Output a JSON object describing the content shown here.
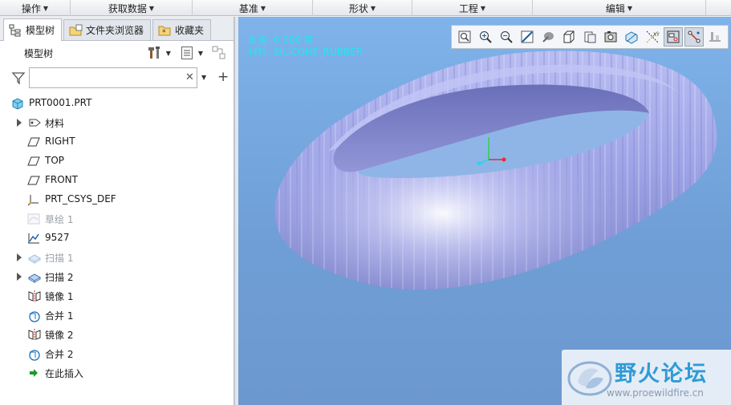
{
  "ribbon": {
    "groups": [
      {
        "label": "操作",
        "width": 88
      },
      {
        "label": "获取数据",
        "width": 152
      },
      {
        "label": "基准",
        "width": 150
      },
      {
        "label": "形状",
        "width": 124
      },
      {
        "label": "工程",
        "width": 150
      },
      {
        "label": "编辑",
        "width": 216
      }
    ]
  },
  "tabs": [
    {
      "label": "模型树",
      "icon": "model-tree-icon",
      "active": true
    },
    {
      "label": "文件夹浏览器",
      "icon": "folder-browser-icon",
      "active": false
    },
    {
      "label": "收藏夹",
      "icon": "favorites-icon",
      "active": false
    }
  ],
  "tree_header": {
    "title": "模型树"
  },
  "search": {
    "value": "",
    "placeholder": ""
  },
  "tree": {
    "root": {
      "label": "PRT0001.PRT",
      "icon": "part-icon"
    },
    "items": [
      {
        "label": "材料",
        "icon": "material-icon",
        "expandable": true,
        "dim": false
      },
      {
        "label": "RIGHT",
        "icon": "datum-plane-icon",
        "expandable": false,
        "dim": false
      },
      {
        "label": "TOP",
        "icon": "datum-plane-icon",
        "expandable": false,
        "dim": false
      },
      {
        "label": "FRONT",
        "icon": "datum-plane-icon",
        "expandable": false,
        "dim": false
      },
      {
        "label": "PRT_CSYS_DEF",
        "icon": "csys-icon",
        "expandable": false,
        "dim": false
      },
      {
        "label": "草绘 1",
        "icon": "sketch-icon",
        "expandable": false,
        "dim": true
      },
      {
        "label": "9527",
        "icon": "curve-icon",
        "expandable": false,
        "dim": false
      },
      {
        "label": "扫描 1",
        "icon": "sweep-icon",
        "expandable": true,
        "dim": true
      },
      {
        "label": "扫描 2",
        "icon": "sweep-icon",
        "expandable": true,
        "dim": false
      },
      {
        "label": "镜像 1",
        "icon": "mirror-icon",
        "expandable": false,
        "dim": false
      },
      {
        "label": "合并 1",
        "icon": "merge-icon",
        "expandable": false,
        "dim": false
      },
      {
        "label": "镜像 2",
        "icon": "mirror-icon",
        "expandable": false,
        "dim": false
      },
      {
        "label": "合并 2",
        "icon": "merge-icon",
        "expandable": false,
        "dim": false
      },
      {
        "label": "在此插入",
        "icon": "insert-here-arrow-icon",
        "expandable": false,
        "dim": false
      }
    ]
  },
  "viewport": {
    "info_line1": "重量: 0.000 克",
    "info_line2": "材料: SILICONE_RUBBER",
    "toolbar_icons": [
      "refit-icon",
      "zoom-in-icon",
      "zoom-out-icon",
      "repaint-icon",
      "display-style-icon",
      "saved-views-icon",
      "view-manager-icon",
      "perspective-icon",
      "section-icon",
      "datum-display-icon",
      "spin-center-icon",
      "annotation-display-icon",
      "plane-display-icon"
    ],
    "shape_color": "#a6abe8",
    "background_top": "#7fb3ea",
    "background_bottom": "#6c98cf"
  },
  "watermark": {
    "title": "野火论坛",
    "url": "www.proewildfire.cn"
  }
}
